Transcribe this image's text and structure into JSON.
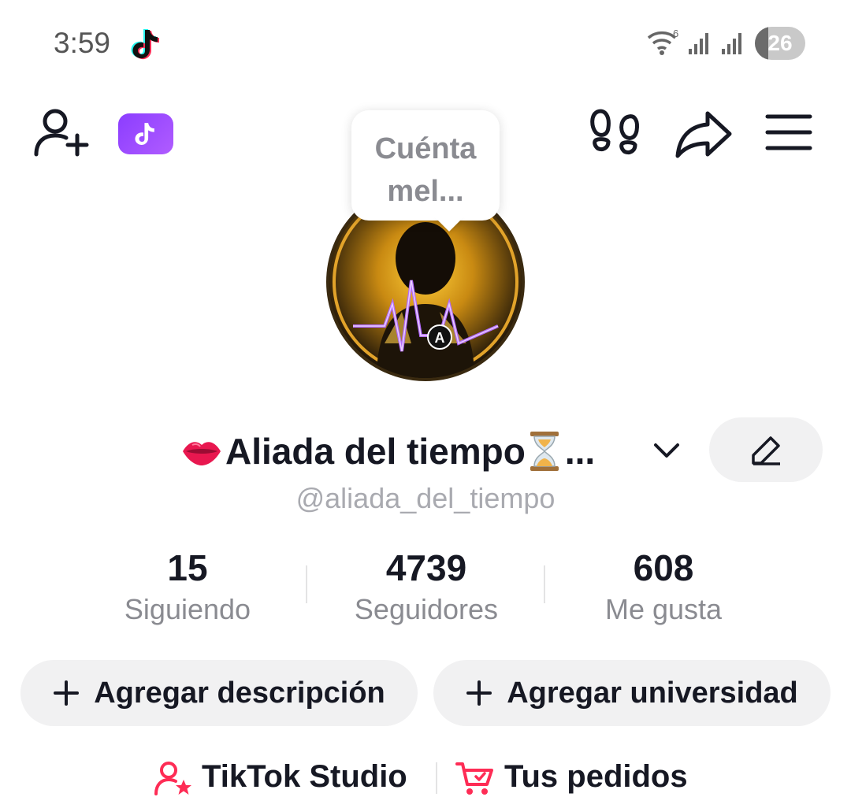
{
  "status_bar": {
    "time": "3:59",
    "wifi_label": "6",
    "battery": "26",
    "battery_level_percent": 26,
    "icons": [
      "tiktok-logo-icon",
      "wifi-icon",
      "signal-icon",
      "signal-icon",
      "battery-icon"
    ]
  },
  "top_bar": {
    "icons": [
      "add-friend-icon",
      "tiktok-promo-badge-icon",
      "footprints-icon",
      "share-icon",
      "menu-icon"
    ]
  },
  "note_bubble": {
    "text": "Cuéntamel..."
  },
  "profile": {
    "avatar_letter": "A",
    "display_name": "Aliada del tiempo",
    "name_emoji_prefix": "lips-emoji",
    "name_emoji_suffix": "hourglass-emoji",
    "name_ellipsis": "...",
    "username": "@aliada_del_tiempo"
  },
  "stats": [
    {
      "value": "15",
      "label": "Siguiendo"
    },
    {
      "value": "4739",
      "label": "Seguidores"
    },
    {
      "value": "608",
      "label": "Me gusta"
    }
  ],
  "actions": {
    "add_description": "Agregar descripción",
    "add_university": "Agregar universidad"
  },
  "links": {
    "studio": "TikTok Studio",
    "orders": "Tus pedidos"
  },
  "colors": {
    "accent": "#fe2c55",
    "promo_purple": "#8b3dff",
    "pill_bg": "#f1f1f2",
    "text_primary": "#161823",
    "text_secondary": "#8a8b91"
  }
}
